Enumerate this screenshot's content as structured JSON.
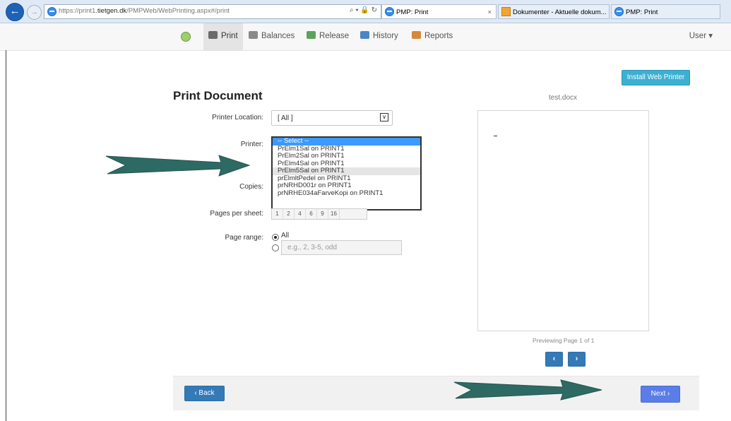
{
  "browser": {
    "url_prefix": "https://print1.",
    "url_domain": "tietgen.dk",
    "url_path": "/PMPWeb/WebPrinting.aspx#/print",
    "address_controls": "⌕ ▾ 🔒 ↻",
    "tabs": [
      {
        "label": "PMP: Print",
        "close": "×"
      },
      {
        "label": "Dokumenter - Aktuelle dokum..."
      },
      {
        "label": "PMP: Print"
      }
    ]
  },
  "nav": {
    "items": [
      "Print",
      "Balances",
      "Release",
      "History",
      "Reports"
    ],
    "user": "User ▾"
  },
  "page": {
    "install_button": "Install Web Printer",
    "title": "Print Document",
    "labels": {
      "location": "Printer Location:",
      "printer": "Printer:",
      "copies": "Copies:",
      "pps": "Pages per sheet:",
      "range": "Page range:"
    },
    "location_value": "[ All ]",
    "printer_options": [
      "-- Select --",
      "PrElm1Sal on PRINT1",
      "PrElm2Sal on PRINT1",
      "PrElm4Sal on PRINT1",
      "PrElm5Sal on PRINT1",
      "prElmltPedel on PRINT1",
      "prNRHD001r on PRINT1",
      "prNRHE034aFarveKopi on PRINT1"
    ],
    "pps_options": [
      "1",
      "2",
      "4",
      "6",
      "9",
      "16"
    ],
    "range_all": "All",
    "range_placeholder": "e.g., 2, 3-5, odd"
  },
  "preview": {
    "filename": "test.docx",
    "page_info": "Previewing Page 1 of 1",
    "prev": "‹",
    "next": "›"
  },
  "footer": {
    "back": "‹ Back",
    "next": "Next ›"
  }
}
